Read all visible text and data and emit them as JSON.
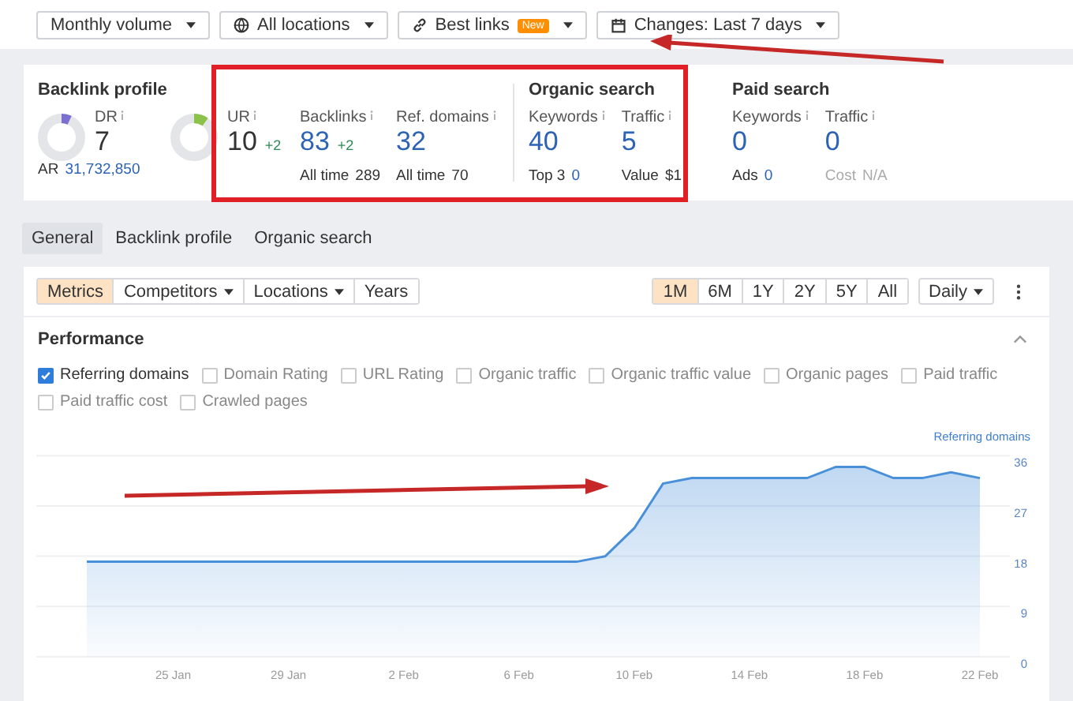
{
  "toolbar": [
    {
      "kind": "plain",
      "label": "Monthly volume"
    },
    {
      "kind": "globe",
      "label": "All locations"
    },
    {
      "kind": "link",
      "label": "Best links",
      "badge": "New"
    },
    {
      "kind": "calendar",
      "label": "Changes: Last 7 days"
    }
  ],
  "overview": [
    {
      "title": "Backlink profile",
      "divider": false,
      "metrics": [
        {
          "kind": "rating",
          "label": "DR",
          "value": "7",
          "level": 0.07,
          "color": "#7b6fd0",
          "sub_label": "AR",
          "sub_value": "31,732,850",
          "sub_link": true,
          "sub_disabled": false
        },
        {
          "kind": "rating",
          "label": "UR",
          "value": "10",
          "change": "+2",
          "level": 0.1,
          "color": "#8bc34a"
        },
        {
          "kind": "count",
          "label": "Backlinks",
          "value": "83",
          "change": "+2",
          "sub_label": "All time",
          "sub_value": "289",
          "sub_link": false,
          "sub_disabled": false
        },
        {
          "kind": "count",
          "label": "Ref. domains",
          "value": "32",
          "sub_label": "All time",
          "sub_value": "70",
          "sub_link": false,
          "sub_disabled": false
        }
      ]
    },
    {
      "title": "Organic search",
      "divider": true,
      "metrics": [
        {
          "kind": "count",
          "label": "Keywords",
          "value": "40",
          "sub_label": "Top 3",
          "sub_value": "0",
          "sub_link": true,
          "sub_disabled": false
        },
        {
          "kind": "count",
          "label": "Traffic",
          "value": "5",
          "sub_label": "Value",
          "sub_value": "$1",
          "sub_link": false,
          "sub_disabled": false
        }
      ]
    },
    {
      "title": "Paid search",
      "divider": false,
      "metrics": [
        {
          "kind": "count",
          "label": "Keywords",
          "value": "0",
          "sub_label": "Ads",
          "sub_value": "0",
          "sub_link": true,
          "sub_disabled": false
        },
        {
          "kind": "count",
          "label": "Traffic",
          "value": "0",
          "sub_label": "Cost",
          "sub_value": "N/A",
          "sub_link": false,
          "sub_disabled": true
        }
      ]
    }
  ],
  "tabs": [
    {
      "label": "General",
      "selected": true
    },
    {
      "label": "Backlink profile",
      "selected": false
    },
    {
      "label": "Organic search",
      "selected": false
    }
  ],
  "view_switch": [
    {
      "label": "Metrics",
      "selected": true,
      "dropdown": false
    },
    {
      "label": "Competitors",
      "selected": false,
      "dropdown": true
    },
    {
      "label": "Locations",
      "selected": false,
      "dropdown": true
    },
    {
      "label": "Years",
      "selected": false,
      "dropdown": false
    }
  ],
  "ranges": [
    {
      "label": "1M",
      "selected": true
    },
    {
      "label": "6M",
      "selected": false
    },
    {
      "label": "1Y",
      "selected": false
    },
    {
      "label": "2Y",
      "selected": false
    },
    {
      "label": "5Y",
      "selected": false
    },
    {
      "label": "All",
      "selected": false
    }
  ],
  "interval": "Daily",
  "performance": {
    "title": "Performance",
    "series_toggles": [
      {
        "label": "Referring domains",
        "checked": true
      },
      {
        "label": "Domain Rating",
        "checked": false
      },
      {
        "label": "URL Rating",
        "checked": false
      },
      {
        "label": "Organic traffic",
        "checked": false
      },
      {
        "label": "Organic traffic value",
        "checked": false
      },
      {
        "label": "Organic pages",
        "checked": false
      },
      {
        "label": "Paid traffic",
        "checked": false
      },
      {
        "label": "Paid traffic cost",
        "checked": false
      },
      {
        "label": "Crawled pages",
        "checked": false
      }
    ],
    "chart_data": {
      "type": "area",
      "grid": true,
      "categories": [
        null,
        null,
        null,
        "25 Jan",
        null,
        null,
        null,
        "29 Jan",
        null,
        null,
        null,
        "2 Feb",
        null,
        null,
        null,
        "6 Feb",
        null,
        null,
        null,
        "10 Feb",
        null,
        null,
        null,
        "14 Feb",
        null,
        null,
        null,
        "18 Feb",
        null,
        null,
        null,
        "22 Feb"
      ],
      "series": [
        {
          "name": "Referring domains",
          "color": "#4a90d9",
          "values": [
            17,
            17,
            17,
            17,
            17,
            17,
            17,
            17,
            17,
            17,
            17,
            17,
            17,
            17,
            17,
            17,
            17,
            17,
            18,
            23,
            31,
            32,
            32,
            32,
            32,
            32,
            34,
            34,
            32,
            32,
            33,
            32
          ]
        }
      ],
      "yticks": [
        0,
        9,
        18,
        27,
        36
      ],
      "ylim": [
        0,
        36
      ]
    }
  },
  "annotations": {
    "highlight_box": true,
    "arrows": true
  }
}
